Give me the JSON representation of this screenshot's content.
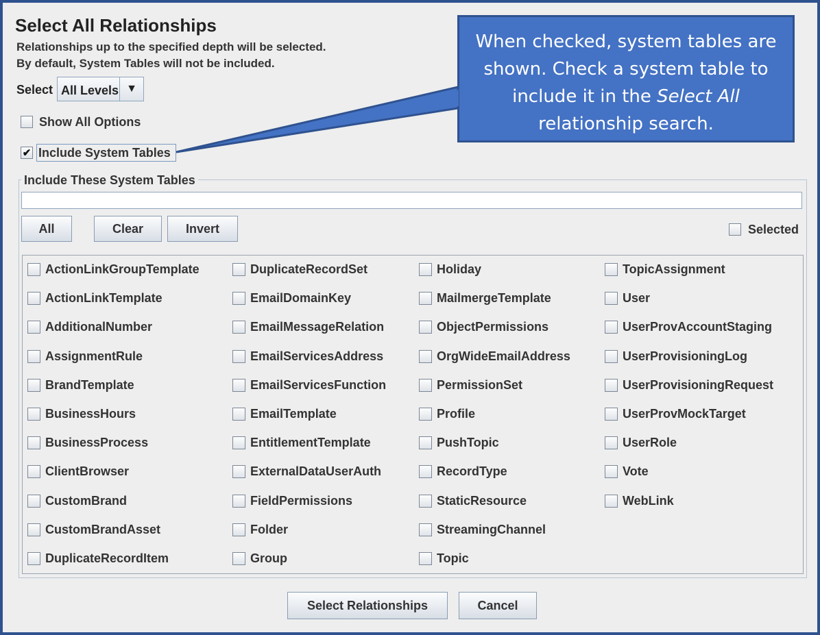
{
  "dialog": {
    "title": "Select All Relationships",
    "description_line1": "Relationships up to the specified depth will be selected.",
    "description_line2": "By default, System Tables will not be included."
  },
  "depth": {
    "label": "Select",
    "value": "All Levels",
    "dropdown_icon": "triangle-down"
  },
  "show_all_options": {
    "label": "Show All Options",
    "checked": false
  },
  "include_system_tables": {
    "label": "Include System Tables",
    "checked": true,
    "check_mark": "✔"
  },
  "system_tables": {
    "group_label": "Include These System Tables",
    "filter_value": "",
    "buttons": {
      "all": "All",
      "clear": "Clear",
      "invert": "Invert"
    },
    "selected_toggle": {
      "label": "Selected",
      "checked": false
    },
    "columns": [
      [
        "ActionLinkGroupTemplate",
        "ActionLinkTemplate",
        "AdditionalNumber",
        "AssignmentRule",
        "BrandTemplate",
        "BusinessHours",
        "BusinessProcess",
        "ClientBrowser",
        "CustomBrand",
        "CustomBrandAsset",
        "DuplicateRecordItem"
      ],
      [
        "DuplicateRecordSet",
        "EmailDomainKey",
        "EmailMessageRelation",
        "EmailServicesAddress",
        "EmailServicesFunction",
        "EmailTemplate",
        "EntitlementTemplate",
        "ExternalDataUserAuth",
        "FieldPermissions",
        "Folder",
        "Group"
      ],
      [
        "Holiday",
        "MailmergeTemplate",
        "ObjectPermissions",
        "OrgWideEmailAddress",
        "PermissionSet",
        "Profile",
        "PushTopic",
        "RecordType",
        "StaticResource",
        "StreamingChannel",
        "Topic"
      ],
      [
        "TopicAssignment",
        "User",
        "UserProvAccountStaging",
        "UserProvisioningLog",
        "UserProvisioningRequest",
        "UserProvMockTarget",
        "UserRole",
        "Vote",
        "WebLink"
      ]
    ]
  },
  "footer": {
    "select_button": "Select Relationships",
    "cancel_button": "Cancel"
  },
  "callout": {
    "line1": "When checked, system tables are",
    "line2": "shown. Check a system table to",
    "line3_before": "include it in the ",
    "line3_emph": "Select All",
    "line4": "relationship search.",
    "fill_color": "#4472c4",
    "border_color": "#2f528f"
  }
}
